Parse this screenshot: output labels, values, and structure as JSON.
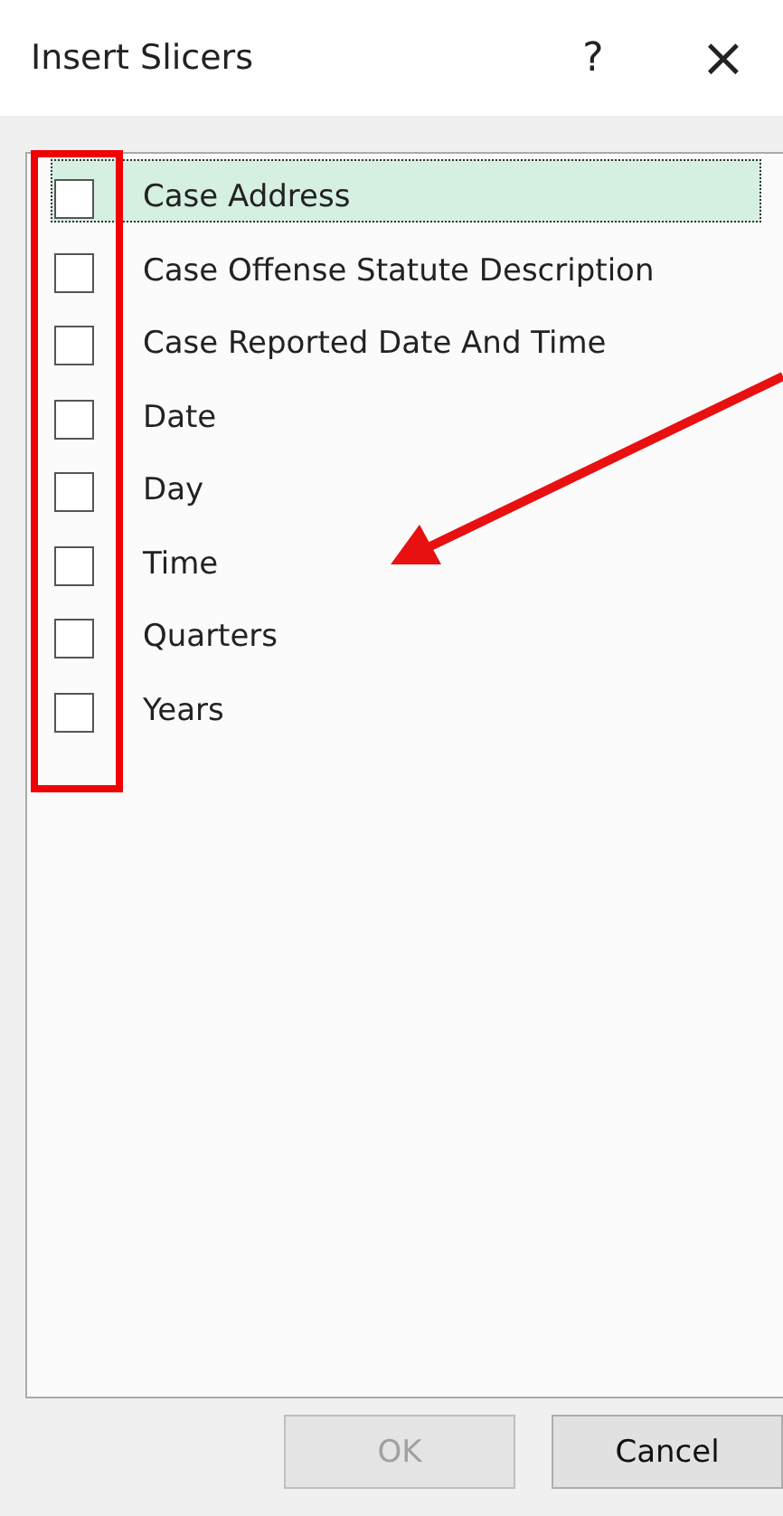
{
  "window": {
    "title": "Insert Slicers",
    "help": "?",
    "close": "×"
  },
  "fields": [
    {
      "label": "Case Address",
      "checked": false,
      "selected": true
    },
    {
      "label": "Case Offense Statute Description",
      "checked": false,
      "selected": false
    },
    {
      "label": "Case Reported Date And Time",
      "checked": false,
      "selected": false
    },
    {
      "label": "Date",
      "checked": false,
      "selected": false
    },
    {
      "label": "Day",
      "checked": false,
      "selected": false
    },
    {
      "label": "Time",
      "checked": false,
      "selected": false
    },
    {
      "label": "Quarters",
      "checked": false,
      "selected": false
    },
    {
      "label": "Years",
      "checked": false,
      "selected": false
    }
  ],
  "buttons": [
    {
      "label": "OK",
      "disabled": true
    },
    {
      "label": "Cancel",
      "disabled": false
    }
  ]
}
